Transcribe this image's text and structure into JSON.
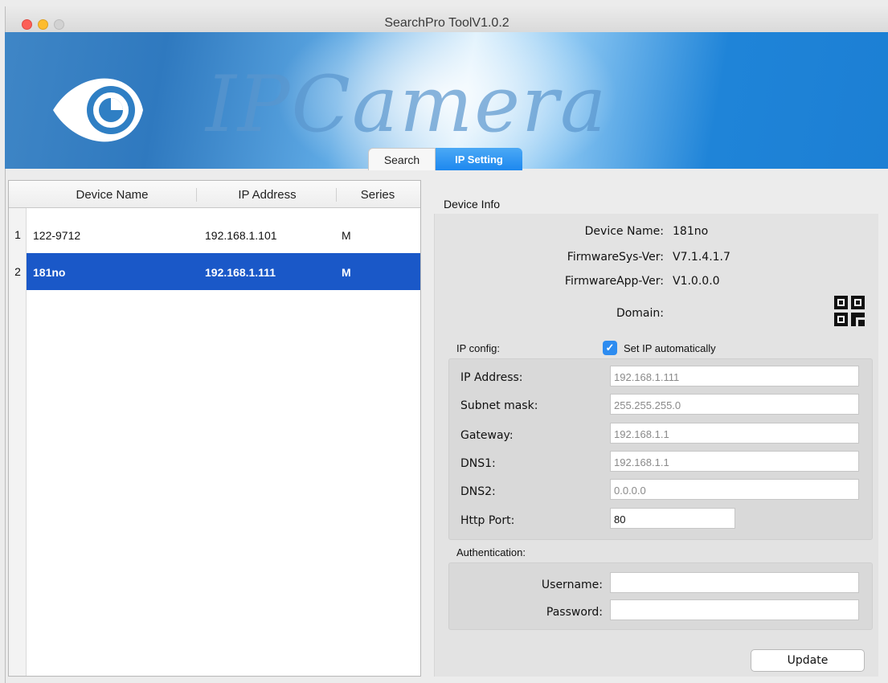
{
  "window": {
    "title": "SearchPro ToolV1.0.2"
  },
  "banner": {
    "brand_text": "IPCamera",
    "logo_icon": "eye-logo-icon",
    "tabs": [
      {
        "label": "Search",
        "active": false
      },
      {
        "label": "IP Setting",
        "active": true
      }
    ]
  },
  "device_table": {
    "headers": [
      "Device Name",
      "IP Address",
      "Series"
    ],
    "rows": [
      {
        "num": "1",
        "name": "122-9712",
        "ip": "192.168.1.101",
        "series": "M",
        "selected": false
      },
      {
        "num": "2",
        "name": "181no",
        "ip": "192.168.1.111",
        "series": "M",
        "selected": true
      }
    ]
  },
  "device_info": {
    "header": "Device Info",
    "device_name_label": "Device Name:",
    "device_name_value": "181no",
    "firmware_sys_label": "FirmwareSys-Ver:",
    "firmware_sys_value": "V7.1.4.1.7",
    "firmware_app_label": "FirmwareApp-Ver:",
    "firmware_app_value": "V1.0.0.0",
    "domain_label": "Domain:",
    "qr_icon": "qr-code-icon"
  },
  "ip_config": {
    "label": "IP config:",
    "auto_checkbox_label": "Set IP automatically",
    "auto_checked": true,
    "fields": [
      {
        "label": "IP Address:",
        "value": "192.168.1.111"
      },
      {
        "label": "Subnet mask:",
        "value": "255.255.255.0"
      },
      {
        "label": "Gateway:",
        "value": "192.168.1.1"
      },
      {
        "label": "DNS1:",
        "value": "192.168.1.1"
      },
      {
        "label": "DNS2:",
        "value": "0.0.0.0"
      },
      {
        "label": "Http Port:",
        "value": "80"
      }
    ]
  },
  "authentication": {
    "label": "Authentication:",
    "username_label": "Username:",
    "username_value": "",
    "password_label": "Password:",
    "password_value": ""
  },
  "actions": {
    "update_label": "Update"
  },
  "colors": {
    "selection": "#1a58c8",
    "tab_active": "#1d88ef",
    "checkbox": "#2d8cf0"
  }
}
